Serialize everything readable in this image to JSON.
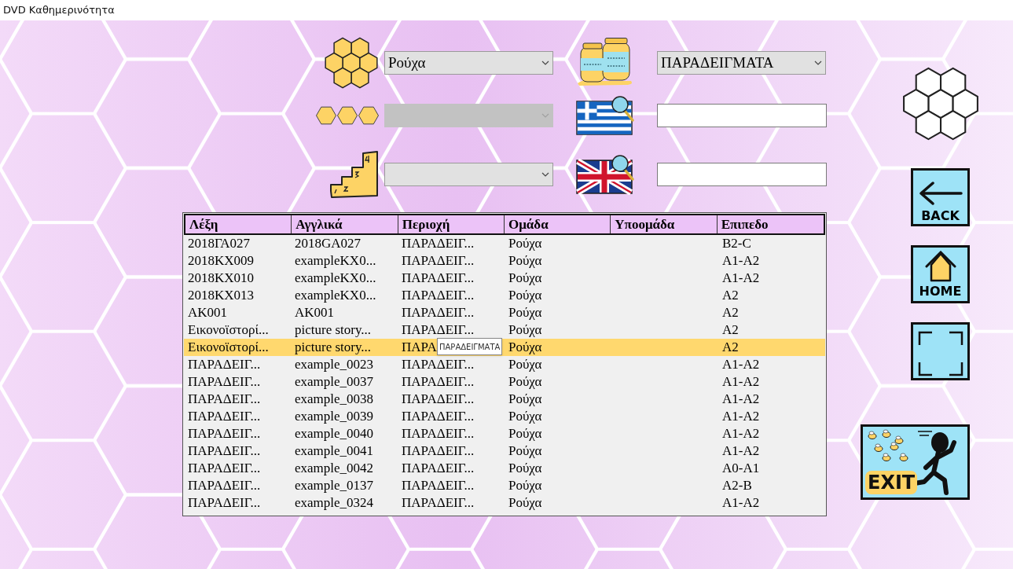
{
  "window": {
    "title": "DVD Καθημερινότητα"
  },
  "filters": [
    {
      "kind": "select",
      "value": "Ρούχα",
      "disabled": false
    },
    {
      "kind": "select",
      "disabled": true
    },
    {
      "kind": "select",
      "disabled": false
    }
  ],
  "search": [
    {
      "kind": "select",
      "value": "ΠΑΡΑΔΕΙΓΜΑΤΑ",
      "disabled": false
    },
    {
      "kind": "input"
    },
    {
      "kind": "input"
    }
  ],
  "table": {
    "columns": [
      "Λέξη",
      "Αγγλικά",
      "Περιοχή",
      "Ομάδα",
      "Υποομάδα",
      "Επιπεδο"
    ],
    "rows": [
      {
        "word": "2018ΓΑ027",
        "english": "2018GA027",
        "region": "ΠΑΡΑΔΕΙΓ...",
        "group": "Ρούχα",
        "level": "B2-C",
        "selected": false
      },
      {
        "word": "2018ΚΧ009",
        "english": "exampleKX0...",
        "region": "ΠΑΡΑΔΕΙΓ...",
        "group": "Ρούχα",
        "level": "A1-A2",
        "selected": false
      },
      {
        "word": "2018ΚΧ010",
        "english": "exampleKX0...",
        "region": "ΠΑΡΑΔΕΙΓ...",
        "group": "Ρούχα",
        "level": "A1-A2",
        "selected": false
      },
      {
        "word": "2018ΚΧ013",
        "english": "exampleKX0...",
        "region": "ΠΑΡΑΔΕΙΓ...",
        "group": "Ρούχα",
        "level": "A2",
        "selected": false
      },
      {
        "word": "ΑΚ001",
        "english": "AK001",
        "region": "ΠΑΡΑΔΕΙΓ...",
        "group": "Ρούχα",
        "level": "A2",
        "selected": false
      },
      {
        "word": "Εικονοϊστορί...",
        "english": "picture story...",
        "region": "ΠΑΡΑΔΕΙΓ...",
        "group": "Ρούχα",
        "level": "A2",
        "selected": false
      },
      {
        "word": "Εικονοϊστορί...",
        "english": "picture story...",
        "region": "ΠΑΡΑ",
        "group": "Ρούχα",
        "level": "A2",
        "selected": true,
        "tooltip": "ΠΑΡΑΔΕΙΓΜΑΤΑ"
      },
      {
        "word": "ΠΑΡΑΔΕΙΓ...",
        "english": "example_0023",
        "region": "ΠΑΡΑΔΕΙΓ...",
        "group": "Ρούχα",
        "level": "A1-A2",
        "selected": false
      },
      {
        "word": "ΠΑΡΑΔΕΙΓ...",
        "english": "example_0037",
        "region": "ΠΑΡΑΔΕΙΓ...",
        "group": "Ρούχα",
        "level": "A1-A2",
        "selected": false
      },
      {
        "word": "ΠΑΡΑΔΕΙΓ...",
        "english": "example_0038",
        "region": "ΠΑΡΑΔΕΙΓ...",
        "group": "Ρούχα",
        "level": "A1-A2",
        "selected": false
      },
      {
        "word": "ΠΑΡΑΔΕΙΓ...",
        "english": "example_0039",
        "region": "ΠΑΡΑΔΕΙΓ...",
        "group": "Ρούχα",
        "level": "A1-A2",
        "selected": false
      },
      {
        "word": "ΠΑΡΑΔΕΙΓ...",
        "english": "example_0040",
        "region": "ΠΑΡΑΔΕΙΓ...",
        "group": "Ρούχα",
        "level": "A1-A2",
        "selected": false
      },
      {
        "word": "ΠΑΡΑΔΕΙΓ...",
        "english": "example_0041",
        "region": "ΠΑΡΑΔΕΙΓ...",
        "group": "Ρούχα",
        "level": "A1-A2",
        "selected": false
      },
      {
        "word": "ΠΑΡΑΔΕΙΓ...",
        "english": "example_0042",
        "region": "ΠΑΡΑΔΕΙΓ...",
        "group": "Ρούχα",
        "level": "A0-A1",
        "selected": false
      },
      {
        "word": "ΠΑΡΑΔΕΙΓ...",
        "english": "example_0137",
        "region": "ΠΑΡΑΔΕΙΓ...",
        "group": "Ρούχα",
        "level": "A2-B",
        "selected": false
      },
      {
        "word": "ΠΑΡΑΔΕΙΓ...",
        "english": "example_0324",
        "region": "ΠΑΡΑΔΕΙΓ...",
        "group": "Ρούχα",
        "level": "A1-A2",
        "selected": false
      }
    ]
  },
  "nav_buttons": [
    {
      "kind": "back",
      "label": "BACK"
    },
    {
      "kind": "home",
      "label": "HOME"
    },
    {
      "kind": "fullscreen"
    },
    {
      "kind": "exit",
      "label": "EXIT"
    }
  ]
}
